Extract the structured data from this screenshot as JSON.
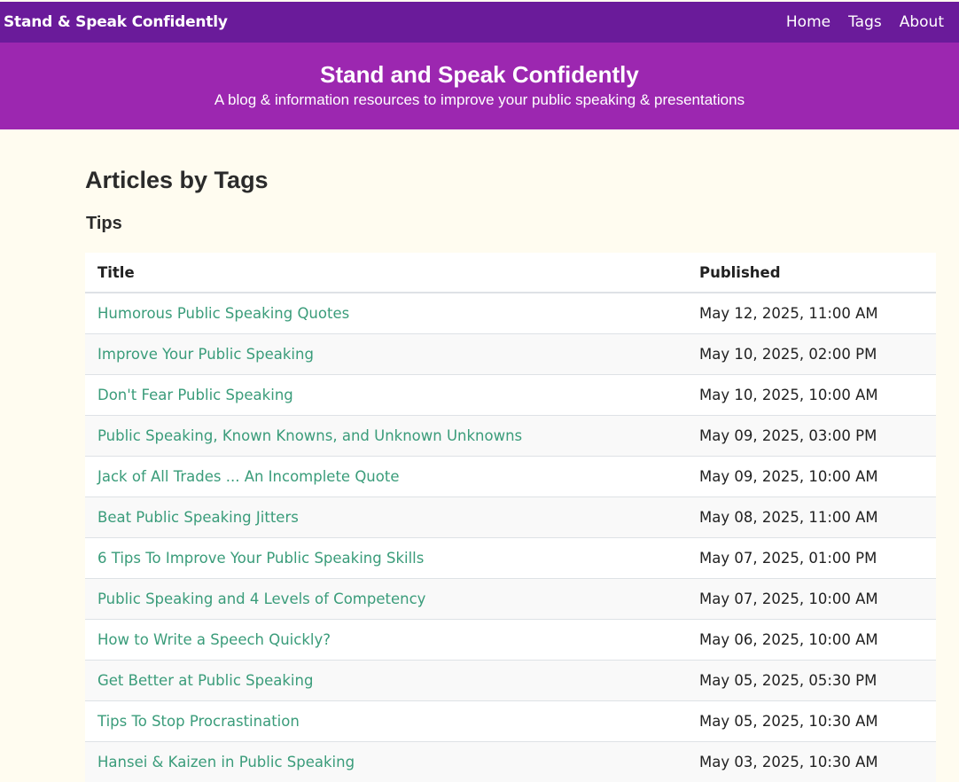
{
  "navbar": {
    "brand": "Stand & Speak Confidently",
    "links": [
      "Home",
      "Tags",
      "About"
    ]
  },
  "hero": {
    "title": "Stand and Speak Confidently",
    "tagline": "A blog & information resources to improve your public speaking & presentations"
  },
  "main": {
    "page_title": "Articles by Tags",
    "tag_name": "Tips",
    "table": {
      "columns": [
        "Title",
        "Published"
      ],
      "rows": [
        {
          "title": "Humorous Public Speaking Quotes",
          "published": "May 12, 2025, 11:00 AM"
        },
        {
          "title": "Improve Your Public Speaking",
          "published": "May 10, 2025, 02:00 PM"
        },
        {
          "title": "Don't Fear Public Speaking",
          "published": "May 10, 2025, 10:00 AM"
        },
        {
          "title": "Public Speaking, Known Knowns, and Unknown Unknowns",
          "published": "May 09, 2025, 03:00 PM"
        },
        {
          "title": "Jack of All Trades ... An Incomplete Quote",
          "published": "May 09, 2025, 10:00 AM"
        },
        {
          "title": "Beat Public Speaking Jitters",
          "published": "May 08, 2025, 11:00 AM"
        },
        {
          "title": "6 Tips To Improve Your Public Speaking Skills",
          "published": "May 07, 2025, 01:00 PM"
        },
        {
          "title": "Public Speaking and 4 Levels of Competency",
          "published": "May 07, 2025, 10:00 AM"
        },
        {
          "title": "How to Write a Speech Quickly?",
          "published": "May 06, 2025, 10:00 AM"
        },
        {
          "title": "Get Better at Public Speaking",
          "published": "May 05, 2025, 05:30 PM"
        },
        {
          "title": "Tips To Stop Procrastination",
          "published": "May 05, 2025, 10:30 AM"
        },
        {
          "title": "Hansei & Kaizen in Public Speaking",
          "published": "May 03, 2025, 10:30 AM"
        }
      ]
    }
  },
  "colors": {
    "navbar": "#6a1b9a",
    "hero": "#9c27b0",
    "link": "#3a9c7a",
    "background": "#fffcf0"
  }
}
